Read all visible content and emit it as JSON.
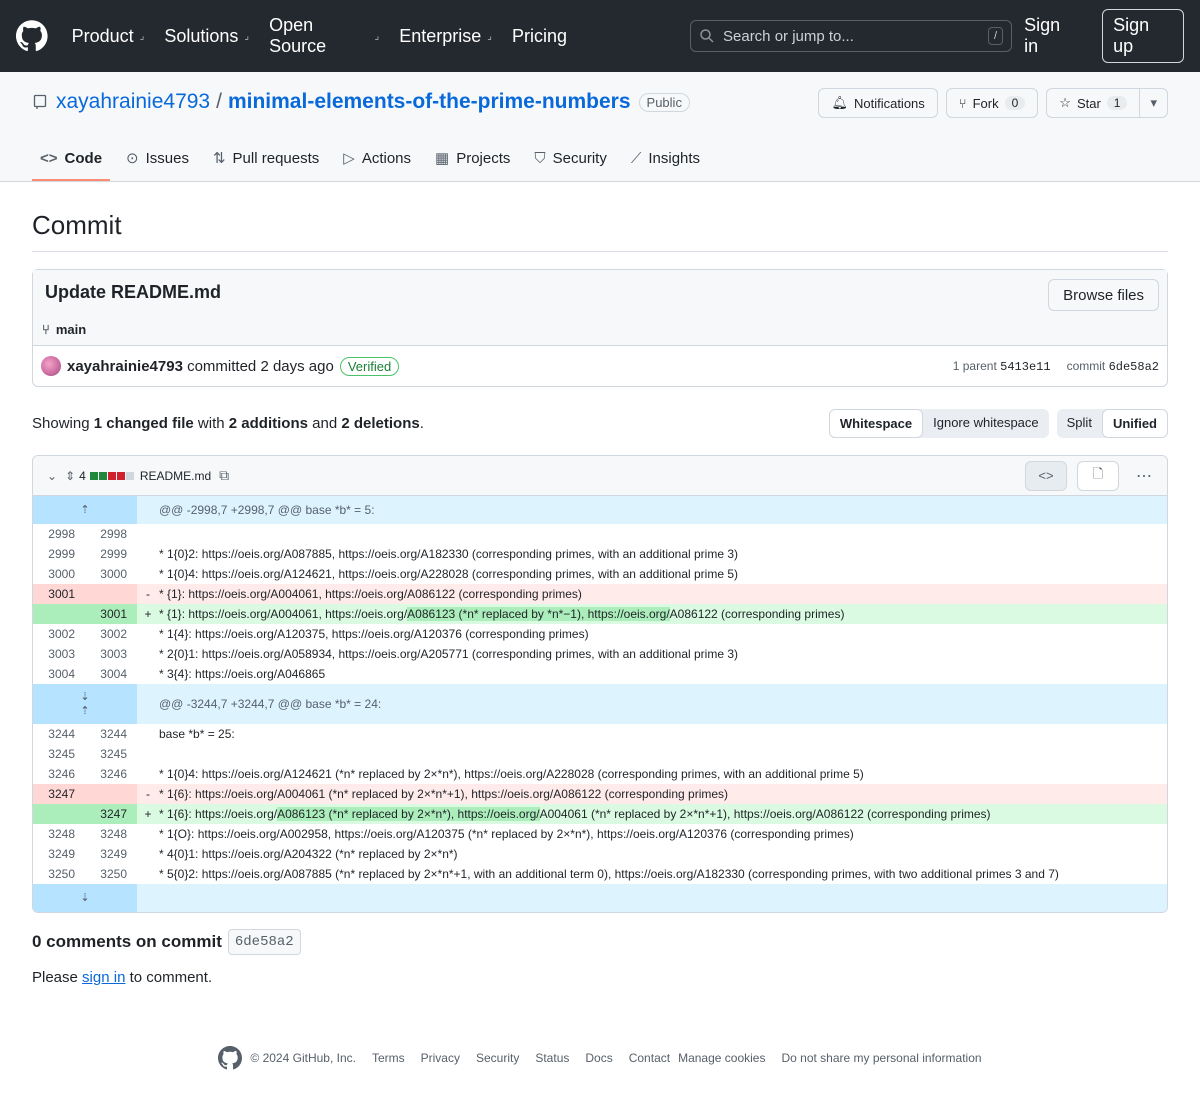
{
  "header": {
    "nav": [
      "Product",
      "Solutions",
      "Open Source",
      "Enterprise",
      "Pricing"
    ],
    "search_placeholder": "Search or jump to...",
    "search_key": "/",
    "sign_in": "Sign in",
    "sign_up": "Sign up"
  },
  "repo": {
    "owner": "xayahrainie4793",
    "sep": "/",
    "name": "minimal-elements-of-the-prime-numbers",
    "visibility": "Public",
    "notifications_label": "Notifications",
    "fork_label": "Fork",
    "fork_count": "0",
    "star_label": "Star",
    "star_count": "1",
    "tabs": [
      "Code",
      "Issues",
      "Pull requests",
      "Actions",
      "Projects",
      "Security",
      "Insights"
    ]
  },
  "page": {
    "title": "Commit"
  },
  "commit": {
    "message": "Update README.md",
    "browse": "Browse files",
    "branch": "main",
    "author": "xayahrainie4793",
    "committed": "committed 2 days ago",
    "verified": "Verified",
    "parent_label": "1 parent",
    "parent_sha": "5413e11",
    "commit_label": "commit",
    "commit_sha": "6de58a2"
  },
  "diffstat": {
    "showing": "Showing",
    "files": "1 changed file",
    "with": "with",
    "additions": "2 additions",
    "and": "and",
    "deletions": "2 deletions",
    "period": ".",
    "whitespace": "Whitespace",
    "ignore_ws": "Ignore whitespace",
    "split": "Split",
    "unified": "Unified"
  },
  "file": {
    "changes": "4",
    "name": "README.md",
    "rows": [
      {
        "type": "hunk",
        "text": "@@ -2998,7 +2998,7 @@ base *b* = 5:",
        "icon": "⇡"
      },
      {
        "type": "ctx",
        "old": "2998",
        "new": "2998",
        "text": ""
      },
      {
        "type": "ctx",
        "old": "2999",
        "new": "2999",
        "text": "* 1{0}2: https://oeis.org/A087885, https://oeis.org/A182330 (corresponding primes, with an additional prime 3)"
      },
      {
        "type": "ctx",
        "old": "3000",
        "new": "3000",
        "text": "* 1{0}4: https://oeis.org/A124621, https://oeis.org/A228028 (corresponding primes, with an additional prime 5)"
      },
      {
        "type": "del",
        "old": "3001",
        "new": "",
        "sign": "-",
        "text": "* {1}: https://oeis.org/A004061, https://oeis.org/A086122 (corresponding primes)"
      },
      {
        "type": "add",
        "old": "",
        "new": "3001",
        "sign": "+",
        "pre": "* {1}: https://oeis.org/A004061, https://oeis.org/",
        "hl": "A086123 (*n* replaced by *n*−1), https://oeis.org/",
        "post": "A086122 (corresponding primes)"
      },
      {
        "type": "ctx",
        "old": "3002",
        "new": "3002",
        "text": "* 1{4}: https://oeis.org/A120375, https://oeis.org/A120376 (corresponding primes)"
      },
      {
        "type": "ctx",
        "old": "3003",
        "new": "3003",
        "text": "* 2{0}1: https://oeis.org/A058934, https://oeis.org/A205771 (corresponding primes, with an additional prime 3)"
      },
      {
        "type": "ctx",
        "old": "3004",
        "new": "3004",
        "text": "* 3{4}: https://oeis.org/A046865"
      },
      {
        "type": "hunk2",
        "text": "@@ -3244,7 +3244,7 @@ base *b* = 24:",
        "icon": "⇣\n⇡"
      },
      {
        "type": "ctx",
        "old": "3244",
        "new": "3244",
        "text": "base *b* = 25:"
      },
      {
        "type": "ctx",
        "old": "3245",
        "new": "3245",
        "text": ""
      },
      {
        "type": "ctx",
        "old": "3246",
        "new": "3246",
        "text": "* 1{0}4: https://oeis.org/A124621 (*n* replaced by 2×*n*), https://oeis.org/A228028 (corresponding primes, with an additional prime 5)"
      },
      {
        "type": "del",
        "old": "3247",
        "new": "",
        "sign": "-",
        "text": "* 1{6}: https://oeis.org/A004061 (*n* replaced by 2×*n*+1), https://oeis.org/A086122 (corresponding primes)"
      },
      {
        "type": "add",
        "old": "",
        "new": "3247",
        "sign": "+",
        "pre": "* 1{6}: https://oeis.org/",
        "hl": "A086123 (*n* replaced by 2×*n*), https://oeis.org/",
        "post": "A004061 (*n* replaced by 2×*n*+1), https://oeis.org/A086122 (corresponding primes)"
      },
      {
        "type": "ctx",
        "old": "3248",
        "new": "3248",
        "text": "* 1{O}: https://oeis.org/A002958, https://oeis.org/A120375 (*n* replaced by 2×*n*), https://oeis.org/A120376 (corresponding primes)"
      },
      {
        "type": "ctx",
        "old": "3249",
        "new": "3249",
        "text": "* 4{0}1: https://oeis.org/A204322 (*n* replaced by 2×*n*)"
      },
      {
        "type": "ctx",
        "old": "3250",
        "new": "3250",
        "text": "* 5{0}2: https://oeis.org/A087885 (*n* replaced by 2×*n*+1, with an additional term 0), https://oeis.org/A182330 (corresponding primes, with two additional primes 3 and 7)"
      },
      {
        "type": "hunkend",
        "text": "",
        "icon": "⇣"
      }
    ]
  },
  "comments": {
    "title": "0 comments on commit",
    "sha": "6de58a2",
    "please": "Please",
    "sign_in": "sign in",
    "to_comment": "to comment."
  },
  "footer": {
    "copyright": "© 2024 GitHub, Inc.",
    "links": [
      "Terms",
      "Privacy",
      "Security",
      "Status",
      "Docs",
      "Contact",
      "Manage cookies",
      "Do not share my personal information"
    ]
  }
}
